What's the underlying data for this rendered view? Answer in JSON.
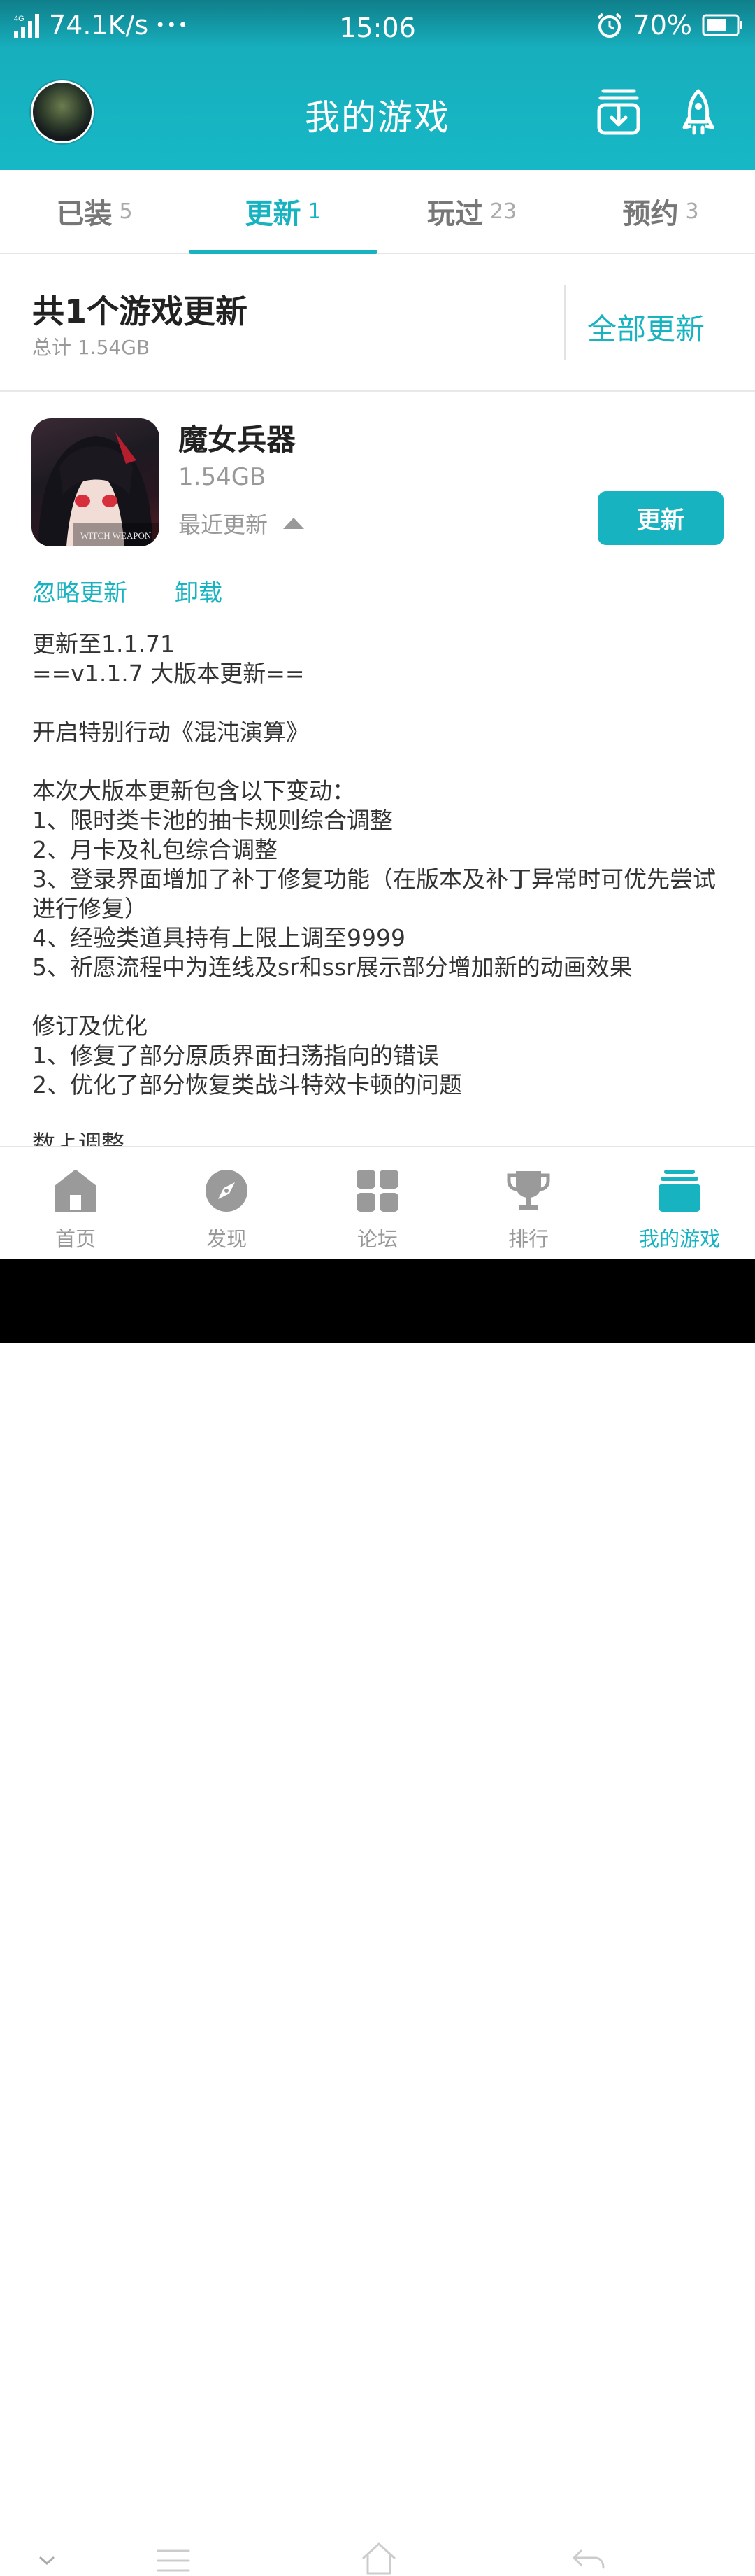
{
  "status_bar": {
    "network": "4G",
    "speed": "74.1K/s",
    "more": "•••",
    "time": "15:06",
    "battery": "70%"
  },
  "app_bar": {
    "title": "我的游戏",
    "icons": [
      "avatar",
      "download-box-icon",
      "rocket-icon"
    ]
  },
  "tabs": [
    {
      "label": "已装",
      "count": "5"
    },
    {
      "label": "更新",
      "count": "1",
      "active": true
    },
    {
      "label": "玩过",
      "count": "23"
    },
    {
      "label": "预约",
      "count": "3"
    }
  ],
  "summary": {
    "title": "共1个游戏更新",
    "subtitle": "总计  1.54GB",
    "update_all": "全部更新"
  },
  "game": {
    "name": "魔女兵器",
    "size": "1.54GB",
    "recent": "最近更新",
    "update_button": "更新",
    "ignore": "忽略更新",
    "uninstall": "卸载",
    "icon_label": "WITCH WEAPON"
  },
  "notes": [
    "更新至1.1.71",
    "==v1.1.7 大版本更新==",
    "",
    "开启特别行动《混沌演算》",
    "",
    "本次大版本更新包含以下变动：",
    "1、限时类卡池的抽卡规则综合调整",
    "2、月卡及礼包综合调整",
    "3、登录界面增加了补丁修复功能（在版本及补丁异常时可优先尝试进行修复）",
    "4、经验类道具持有上限上调至9999",
    "5、祈愿流程中为连线及sr和ssr展示部分增加新的动画效果",
    "",
    "修订及优化",
    "1、修复了部分原质界面扫荡指向的错误",
    "2、优化了部分恢复类战斗特效卡顿的问题",
    "",
    "数よ调整"
  ],
  "bottom_nav": [
    {
      "label": "首页",
      "icon": "home-icon"
    },
    {
      "label": "发现",
      "icon": "compass-icon"
    },
    {
      "label": "论坛",
      "icon": "grid-icon"
    },
    {
      "label": "排行",
      "icon": "trophy-icon"
    },
    {
      "label": "我的游戏",
      "icon": "my-games-icon",
      "active": true
    }
  ],
  "colors": {
    "accent": "#17b3c1",
    "header": "#17b8c6"
  }
}
